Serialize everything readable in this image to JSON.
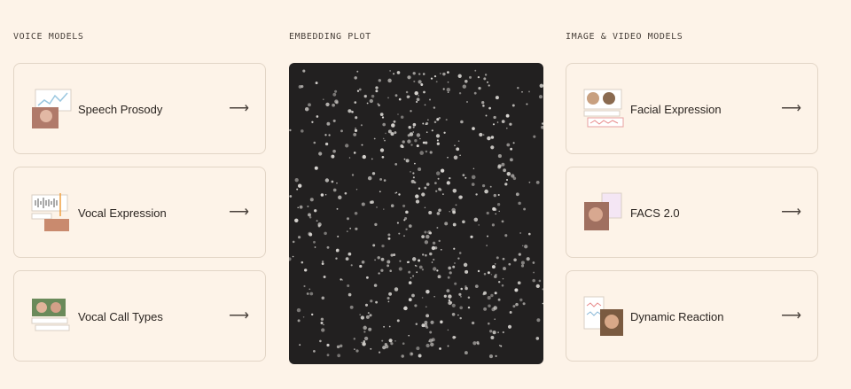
{
  "columns": {
    "voice": "VOICE MODELS",
    "embedding": "EMBEDDING PLOT",
    "image_video": "IMAGE & VIDEO MODELS"
  },
  "voice_models": [
    {
      "title": "Speech Prosody",
      "icon": "arrow-right-icon"
    },
    {
      "title": "Vocal Expression",
      "icon": "arrow-right-icon"
    },
    {
      "title": "Vocal Call Types",
      "icon": "arrow-right-icon"
    }
  ],
  "image_video_models": [
    {
      "title": "Facial Expression",
      "icon": "arrow-right-icon"
    },
    {
      "title": "FACS 2.0",
      "icon": "arrow-right-icon"
    },
    {
      "title": "Dynamic Reaction",
      "icon": "arrow-right-icon"
    }
  ],
  "arrow_glyph": "⟶",
  "colors": {
    "background": "#fdf3e8",
    "card_border": "#e2d5c6",
    "plot_background": "#222020",
    "plot_points": "#d9d6d2"
  }
}
